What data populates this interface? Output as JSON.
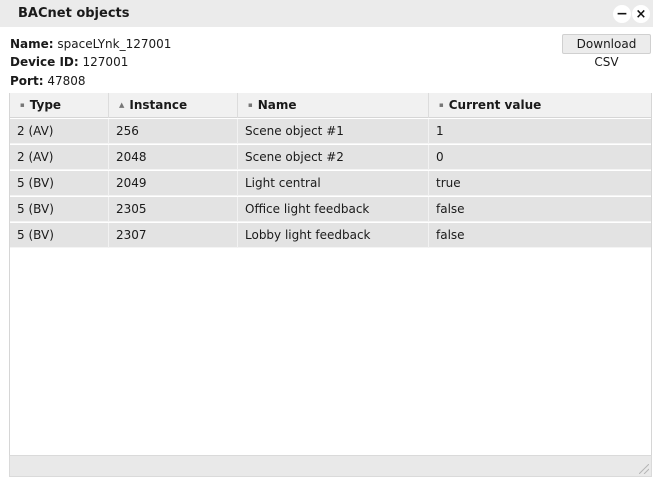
{
  "window": {
    "title": "BACnet objects",
    "minimize_symbol": "−",
    "close_symbol": "×"
  },
  "info": {
    "name_label": "Name:",
    "name_value": "spaceLYnk_127001",
    "device_id_label": "Device ID:",
    "device_id_value": "127001",
    "port_label": "Port:",
    "port_value": "47808"
  },
  "toolbar": {
    "download_csv_label": "Download CSV"
  },
  "table": {
    "columns": [
      {
        "label": "Type",
        "sort_icon": "sort-neutral-icon",
        "sort_glyph": "▪"
      },
      {
        "label": "Instance",
        "sort_icon": "sort-ascending-icon",
        "sort_glyph": "▲"
      },
      {
        "label": "Name",
        "sort_icon": "sort-neutral-icon",
        "sort_glyph": "▪"
      },
      {
        "label": "Current value",
        "sort_icon": "sort-neutral-icon",
        "sort_glyph": "▪"
      }
    ],
    "rows": [
      {
        "type": "2 (AV)",
        "instance": "256",
        "name": "Scene object #1",
        "value": "1"
      },
      {
        "type": "2 (AV)",
        "instance": "2048",
        "name": "Scene object #2",
        "value": "0"
      },
      {
        "type": "5 (BV)",
        "instance": "2049",
        "name": "Light central",
        "value": "true"
      },
      {
        "type": "5 (BV)",
        "instance": "2305",
        "name": "Office light feedback",
        "value": "false"
      },
      {
        "type": "5 (BV)",
        "instance": "2307",
        "name": "Lobby light feedback",
        "value": "false"
      }
    ]
  },
  "colors": {
    "titlebar": "#ebebeb",
    "header": "#f1f1f1",
    "row": "#e3e3e3",
    "statusbar": "#e9e9e9"
  }
}
